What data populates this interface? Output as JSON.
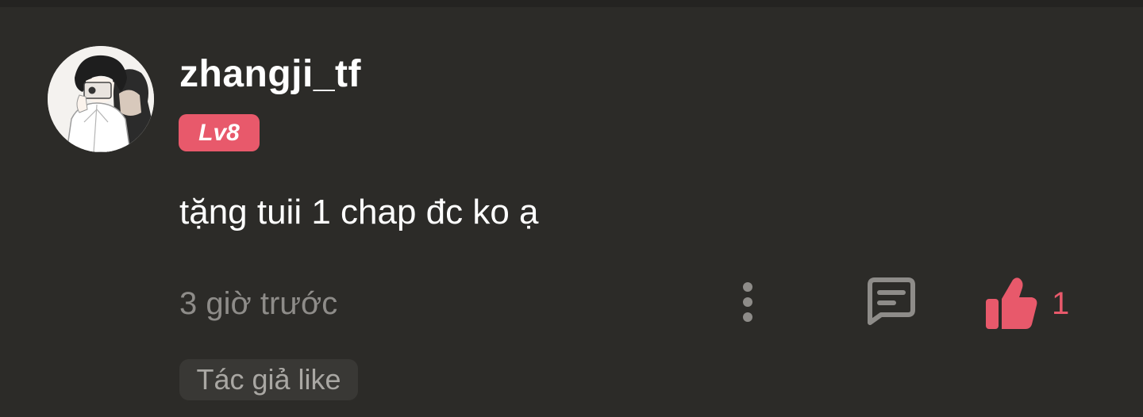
{
  "comment": {
    "username": "zhangji_tf",
    "level_badge": "Lv8",
    "text": "tặng tuii 1 chap đc ko ạ",
    "timestamp": "3 giờ trước",
    "like_count": "1",
    "author_like_label": "Tác giả like",
    "avatar_icon": "user-avatar",
    "more_icon": "more-vertical-icon",
    "reply_icon": "comment-reply-icon",
    "like_icon": "thumbs-up-icon"
  },
  "colors": {
    "background": "#2c2b28",
    "accent": "#e8596b",
    "muted_text": "#8e8c89",
    "badge_background": "#393835"
  }
}
